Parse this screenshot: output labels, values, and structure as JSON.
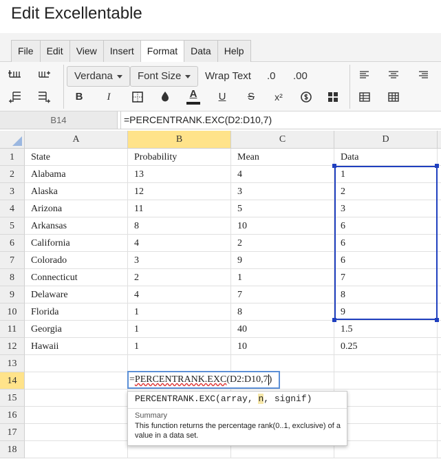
{
  "window": {
    "title": "Edit Excellentable"
  },
  "menu": [
    "File",
    "Edit",
    "View",
    "Insert",
    "Format",
    "Data",
    "Help"
  ],
  "menu_active": "Format",
  "toolbar": {
    "font_family": "Verdana",
    "font_size": "Font Size",
    "wrap_text": "Wrap Text",
    "decimal_decrease": ".0",
    "decimal_increase": ".00",
    "bold": "B",
    "italic": "I",
    "font_color": "A",
    "underline": "U",
    "strike": "S",
    "superscript": "x²"
  },
  "formula_bar": {
    "cell_ref": "B14",
    "formula": "=PERCENTRANK.EXC(D2:D10,7)"
  },
  "columns": [
    "A",
    "B",
    "C",
    "D"
  ],
  "selected_column": "B",
  "row_numbers": [
    "1",
    "2",
    "3",
    "4",
    "5",
    "6",
    "7",
    "8",
    "9",
    "10",
    "11",
    "12",
    "13",
    "14",
    "15",
    "16",
    "17",
    "18"
  ],
  "selected_row": "14",
  "rows": [
    [
      "State",
      "Probability",
      "Mean",
      "Data"
    ],
    [
      "Alabama",
      "13",
      "4",
      "1"
    ],
    [
      "Alaska",
      "12",
      "3",
      "2"
    ],
    [
      "Arizona",
      "11",
      "5",
      "3"
    ],
    [
      "Arkansas",
      "8",
      "10",
      "6"
    ],
    [
      "California",
      "4",
      "2",
      "6"
    ],
    [
      "Colorado",
      "3",
      "9",
      "6"
    ],
    [
      "Connecticut",
      "2",
      "1",
      "7"
    ],
    [
      "Delaware",
      "4",
      "7",
      "8"
    ],
    [
      "Florida",
      "1",
      "8",
      "9"
    ],
    [
      "Georgia",
      "1",
      "40",
      "1.5"
    ],
    [
      "Hawaii",
      "1",
      "10",
      "0.25"
    ]
  ],
  "editor": {
    "prefix": "=",
    "func": "PERCENTRANK.EXC",
    "args": "(D2:D10,7",
    "suffix": ")"
  },
  "tooltip": {
    "sig_pre": "PERCENTRANK.EXC(array, ",
    "sig_hl": "n",
    "sig_post": ", signif)",
    "summary_label": "Summary",
    "description": "This function returns the percentage rank(0..1, exclusive) of a value in a data set."
  }
}
